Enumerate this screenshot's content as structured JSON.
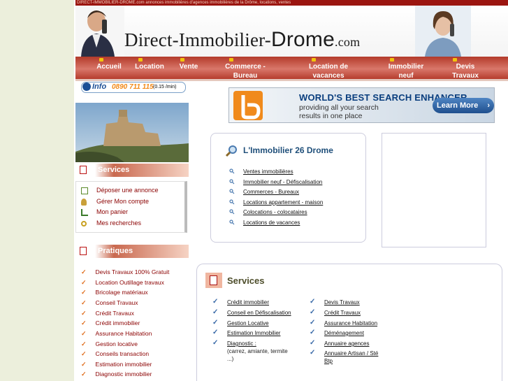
{
  "topbar": {
    "text": "DIRECT-IMMOBILIER-DROME.com annonces immobilières d'agences immobilières de la Drôme, locations, ventes"
  },
  "brand": {
    "prefix": "Direct-Immobilier-",
    "main": "Drome",
    "suffix": ".com"
  },
  "nav": {
    "items": [
      {
        "line1": "Accueil",
        "line2": ""
      },
      {
        "line1": "Location",
        "line2": ""
      },
      {
        "line1": "Vente",
        "line2": ""
      },
      {
        "line1": "Commerce -",
        "line2": "Bureau"
      },
      {
        "line1": "Location de",
        "line2": "vacances"
      },
      {
        "line1": "Immobilier",
        "line2": "neuf"
      },
      {
        "line1": "Devis",
        "line2": "Travaux"
      }
    ]
  },
  "phone": {
    "info": "Info",
    "number": "0890 711 115",
    "cost": "(0.15 /min)"
  },
  "ad": {
    "headline": "WORLD'S BEST SEARCH ENHANCER",
    "body": "providing all your search results in one place",
    "button": "Learn More"
  },
  "sidebar": {
    "services_title": "Services",
    "services": [
      {
        "label": "Déposer une annonce",
        "icon": "document-icon"
      },
      {
        "label": "Gérer Mon compte",
        "icon": "user-icon"
      },
      {
        "label": "Mon panier",
        "icon": "cart-icon"
      },
      {
        "label": "Mes recherches",
        "icon": "search-icon"
      }
    ],
    "pratiques_title": "Pratiques",
    "pratiques": [
      "Devis Travaux 100% Gratuit",
      "Location Outillage travaux",
      "Bricolage matériaux",
      "Conseil Travaux",
      "Crédit Travaux",
      "Crédit immobilier",
      "Assurance Habitation",
      "Gestion locative",
      "Conseils transaction",
      "Estimation immobilier",
      "Diagnostic immobilier"
    ]
  },
  "immobilier": {
    "title": "L'Immobilier 26 Drome",
    "links": [
      "Ventes immobilières",
      "Immobilier neuf - Défiscalisation",
      "Commerces - Bureaux",
      "Locations appartement - maison",
      "Colocations - colocataires",
      "Locations de vacances"
    ]
  },
  "services": {
    "title": "Services",
    "col1": [
      "Crédit immobilier",
      "Conseil en Défiscalisation",
      "Gestion Locative",
      "Estimation Immobilier",
      "Diagnostic :"
    ],
    "col1_note": [
      "(carrez, amiante, termite",
      "...)"
    ],
    "col2": [
      "Devis Travaux",
      "Crédit Travaux",
      "Assurance Habitation",
      "Déménagement",
      "Annuaire agences",
      "Annuaire Artisan / Sté"
    ],
    "col2_note": "Btp"
  },
  "colors": {
    "nav_red": "#b33a2a",
    "link_red": "#8b0000",
    "title_blue": "#1f4f7a",
    "accent_orange": "#e07020"
  }
}
